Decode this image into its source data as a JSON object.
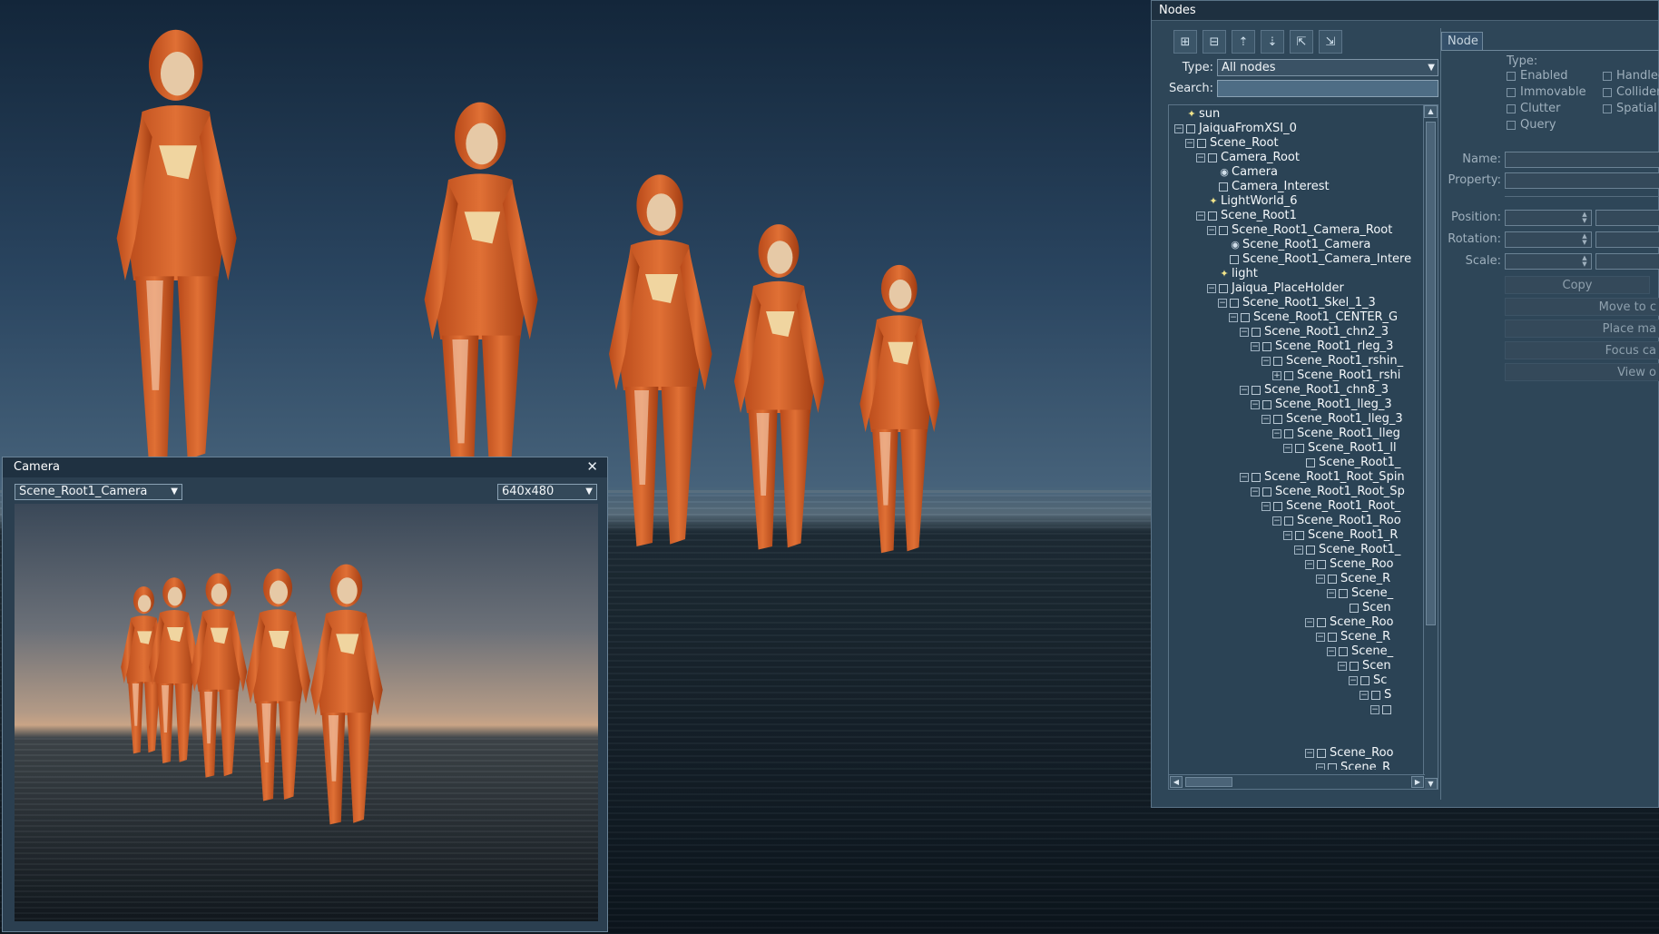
{
  "nodes_panel": {
    "title": "Nodes",
    "toolbar_icons": [
      "expand-all-icon",
      "collapse-all-icon",
      "move-up-icon",
      "move-down-icon",
      "export-icon",
      "import-icon"
    ],
    "type_label": "Type:",
    "type_value": "All nodes",
    "search_label": "Search:",
    "search_value": "",
    "tree": [
      {
        "label": "sun",
        "depth": 0,
        "expander": "none",
        "icon": "light"
      },
      {
        "label": "JaiquaFromXSI_0",
        "depth": 0,
        "expander": "-",
        "icon": "box"
      },
      {
        "label": "Scene_Root",
        "depth": 1,
        "expander": "-",
        "icon": "box"
      },
      {
        "label": "Camera_Root",
        "depth": 2,
        "expander": "-",
        "icon": "box"
      },
      {
        "label": "Camera",
        "depth": 3,
        "expander": "none",
        "icon": "camera"
      },
      {
        "label": "Camera_Interest",
        "depth": 3,
        "expander": "none",
        "icon": "box"
      },
      {
        "label": "LightWorld_6",
        "depth": 2,
        "expander": "none",
        "icon": "light"
      },
      {
        "label": "Scene_Root1",
        "depth": 2,
        "expander": "-",
        "icon": "box"
      },
      {
        "label": "Scene_Root1_Camera_Root",
        "depth": 3,
        "expander": "-",
        "icon": "box"
      },
      {
        "label": "Scene_Root1_Camera",
        "depth": 4,
        "expander": "none",
        "icon": "camera"
      },
      {
        "label": "Scene_Root1_Camera_Intere",
        "depth": 4,
        "expander": "none",
        "icon": "box"
      },
      {
        "label": "light",
        "depth": 3,
        "expander": "none",
        "icon": "light"
      },
      {
        "label": "Jaiqua_PlaceHolder",
        "depth": 3,
        "expander": "-",
        "icon": "box"
      },
      {
        "label": "Scene_Root1_Skel_1_3",
        "depth": 4,
        "expander": "-",
        "icon": "box"
      },
      {
        "label": "Scene_Root1_CENTER_G",
        "depth": 5,
        "expander": "-",
        "icon": "box"
      },
      {
        "label": "Scene_Root1_chn2_3",
        "depth": 6,
        "expander": "-",
        "icon": "box"
      },
      {
        "label": "Scene_Root1_rleg_3",
        "depth": 7,
        "expander": "-",
        "icon": "box"
      },
      {
        "label": "Scene_Root1_rshin_",
        "depth": 8,
        "expander": "-",
        "icon": "box"
      },
      {
        "label": "Scene_Root1_rshi",
        "depth": 9,
        "expander": "+",
        "icon": "box"
      },
      {
        "label": "Scene_Root1_chn8_3",
        "depth": 6,
        "expander": "-",
        "icon": "box"
      },
      {
        "label": "Scene_Root1_lleg_3",
        "depth": 7,
        "expander": "-",
        "icon": "box"
      },
      {
        "label": "Scene_Root1_lleg_3",
        "depth": 8,
        "expander": "-",
        "icon": "box"
      },
      {
        "label": "Scene_Root1_lleg",
        "depth": 9,
        "expander": "-",
        "icon": "box"
      },
      {
        "label": "Scene_Root1_ll",
        "depth": 10,
        "expander": "-",
        "icon": "box"
      },
      {
        "label": "Scene_Root1_",
        "depth": 11,
        "expander": "none",
        "icon": "box"
      },
      {
        "label": "Scene_Root1_Root_Spin",
        "depth": 6,
        "expander": "-",
        "icon": "box"
      },
      {
        "label": "Scene_Root1_Root_Sp",
        "depth": 7,
        "expander": "-",
        "icon": "box"
      },
      {
        "label": "Scene_Root1_Root_",
        "depth": 8,
        "expander": "-",
        "icon": "box"
      },
      {
        "label": "Scene_Root1_Roo",
        "depth": 9,
        "expander": "-",
        "icon": "box"
      },
      {
        "label": "Scene_Root1_R",
        "depth": 10,
        "expander": "-",
        "icon": "box"
      },
      {
        "label": "Scene_Root1_",
        "depth": 11,
        "expander": "-",
        "icon": "box"
      },
      {
        "label": "Scene_Roo",
        "depth": 12,
        "expander": "-",
        "icon": "box"
      },
      {
        "label": "Scene_R",
        "depth": 13,
        "expander": "-",
        "icon": "box"
      },
      {
        "label": "Scene_",
        "depth": 14,
        "expander": "-",
        "icon": "box"
      },
      {
        "label": "Scen",
        "depth": 15,
        "expander": "none",
        "icon": "box"
      },
      {
        "label": "Scene_Roo",
        "depth": 12,
        "expander": "-",
        "icon": "box"
      },
      {
        "label": "Scene_R",
        "depth": 13,
        "expander": "-",
        "icon": "box"
      },
      {
        "label": "Scene_",
        "depth": 14,
        "expander": "-",
        "icon": "box"
      },
      {
        "label": "Scen",
        "depth": 15,
        "expander": "-",
        "icon": "box"
      },
      {
        "label": "Sc",
        "depth": 16,
        "expander": "-",
        "icon": "box"
      },
      {
        "label": "S",
        "depth": 17,
        "expander": "-",
        "icon": "box"
      },
      {
        "label": "",
        "depth": 18,
        "expander": "-",
        "icon": "box"
      },
      {
        "label": "",
        "depth": 19,
        "expander": "none",
        "icon": "none"
      },
      {
        "label": "",
        "depth": 19,
        "expander": "none",
        "icon": "none"
      },
      {
        "label": "Scene_Roo",
        "depth": 12,
        "expander": "-",
        "icon": "box"
      },
      {
        "label": "Scene_R",
        "depth": 13,
        "expander": "-",
        "icon": "box"
      }
    ],
    "node_tab": "Node",
    "props": {
      "type_label": "Type:",
      "checkboxes_left": [
        "Enabled",
        "Immovable",
        "Clutter",
        "Query"
      ],
      "checkboxes_right": [
        "Handled",
        "Collider",
        "Spatial"
      ],
      "name_label": "Name:",
      "property_label": "Property:",
      "position_label": "Position:",
      "rotation_label": "Rotation:",
      "scale_label": "Scale:",
      "copy_button": "Copy",
      "move_to_button": "Move to c",
      "place_button": "Place ma",
      "focus_button": "Focus ca",
      "view_button": "View o"
    }
  },
  "camera_window": {
    "title": "Camera",
    "close_glyph": "✕",
    "camera_select": "Scene_Root1_Camera",
    "resolution_select": "640x480"
  }
}
